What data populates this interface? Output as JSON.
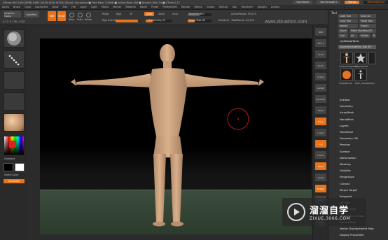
{
  "app": {
    "title": "ZBrush 4R7 [49:I]ZBPB-D4BF-QQ3H-6OHI-HOZ4]    ZBrush Document    ■ Free Mem 3.446B ■ Active Mem 456 ■ Scratch Disk 34 ■ ZTime 0.17",
    "quicksave": "QuickSave",
    "seethrough": "See-through  0",
    "menus_label": "Menus",
    "default_script": "DefaultZScript"
  },
  "menu": [
    "Alpha",
    "Brush",
    "Color",
    "Document",
    "Draw",
    "Edit",
    "File",
    "Layer",
    "Light",
    "Macro",
    "Marker",
    "Material",
    "Movie",
    "Picker",
    "Preferences",
    "Render",
    "Stencil",
    "Stroke",
    "Texture",
    "Tool",
    "Transform",
    "Zplugin",
    "Zscript"
  ],
  "toolbar": {
    "projection_master": "Projection Master",
    "lightbox": "LightBox",
    "edit": "Edit",
    "draw": "Draw",
    "move": "Move",
    "scale": "Scale",
    "rotate": "Rotate",
    "mrgb": "Mrgb",
    "rgb": "Rgb",
    "m": "M",
    "zadd": "Zadd",
    "zsub": "Zsub",
    "zcut": "Zcut",
    "focal_shift_label": "Focal Shift",
    "focal_shift_value": "0",
    "draw_size_label": "Draw Size",
    "draw_size_value": "64",
    "dynamic": "Dynamic",
    "z_intensity_label": "Z Intensity",
    "z_intensity_value": "25",
    "rgb_intensity_label": "Rgb Intensity",
    "rgb_intensity_value": "100",
    "active_points_label": "ActivePoints:",
    "active_points_value": "55,274",
    "total_points_label": "TotalPoints:",
    "total_points_value": "55,274",
    "coords": "0.17, 0.176, -0.82"
  },
  "left_shelf": {
    "gradient_label": "Gradient",
    "switch_color_label": "SwitchColor",
    "alternate_label": "Alternate"
  },
  "right_shelf": [
    "BPR",
    "SPix 3",
    "Scroll",
    "Zoom",
    "Actual",
    "AAHalf",
    "Dynamic",
    "Persp",
    "Floor",
    "L.Sym",
    "Xyz",
    "Frame",
    "Move",
    "Scale",
    "Rotate",
    "PolyF",
    "Transp",
    "Solo"
  ],
  "tool_palette": {
    "title": "Tool",
    "buttons": [
      "Load Tool",
      "Save As",
      "Copy Tool",
      "Paste Tool",
      "Import",
      "Export",
      "Clone",
      "Make PolyMesh3D",
      "GoZ",
      "All",
      "Visible",
      "R"
    ],
    "lightbox_tools": "Lightbox▸Tools",
    "current_tool": "SuperAverageMan_low. 48",
    "thumb_labels": [
      "SuperAverageMan",
      "PolyMesh3D",
      "SimpleBrush",
      "Mem_AverageMan"
    ],
    "sections": [
      "SubTool",
      "Geometry",
      "ArrayMesh",
      "NanoMesh",
      "Layers",
      "FiberMesh",
      "Geometry HD",
      "Preview",
      "Surface",
      "Deformation",
      "Masking",
      "Visibility",
      "Polygroups",
      "Contact",
      "Morph Target",
      "Polypaint",
      "UV Map",
      "Texture Map",
      "Displacement Map",
      "Normal Map",
      "Vector Displacement Map",
      "Display Properties"
    ]
  },
  "watermark": {
    "cn": "溜溜自学",
    "url": "ZIXUE.3066.COM",
    "top_url": "www.zbrushcn.com"
  }
}
